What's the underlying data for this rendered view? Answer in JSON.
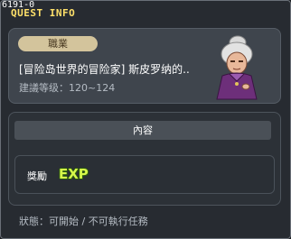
{
  "window": {
    "quest_code": "6191-0",
    "title": "QUEST INFO"
  },
  "quest": {
    "category_badge": "職業",
    "name": "[冒险岛世界的冒险家] 斯皮罗纳的..",
    "level_text": "建議等级：120~124",
    "npc_icon": "old-woman-npc-portrait"
  },
  "content": {
    "tab_label": "內容",
    "reward_label": "獎勵",
    "reward_exp": "EXP"
  },
  "footer": {
    "status_text": "狀態：可開始 / 不可執行任務"
  },
  "colors": {
    "title": "#ffe16a",
    "badge_bg": "#d3c49c",
    "exp": "#d6f84a"
  }
}
